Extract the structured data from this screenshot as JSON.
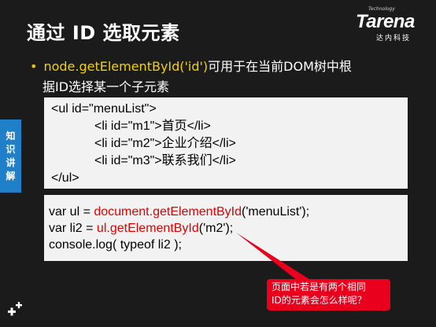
{
  "slide": {
    "title": "通过 ID 选取元素",
    "side_tab": [
      "知",
      "识",
      "讲",
      "解"
    ]
  },
  "logo": {
    "small": "Technology",
    "main": "Tarena",
    "sub": "达内科技"
  },
  "bullet": {
    "dot": "•",
    "code": "node.getElementById('id')",
    "text1": "可用于在当前DOM树中根",
    "text2": "据ID选择某一个子元素"
  },
  "code_html": {
    "line1": "<ul id=\"menuList\">",
    "line2_pre": "<li id=\"m1\">",
    "line2_text": "首页",
    "line2_post": "</li>",
    "line3_pre": "<li id=\"m2\">",
    "line3_text": "企业介绍",
    "line3_post": "</li>",
    "line4_pre": "<li id=\"m3\">",
    "line4_text": "联系我们",
    "line4_post": "</li>",
    "line5": "</ul>"
  },
  "code_js": {
    "line1_a": "var ul = ",
    "line1_b": "document.getElementById",
    "line1_c": "('menuList');",
    "line2_a": "var li2 = ",
    "line2_b": "ul.getElementById",
    "line2_c": "('m2');",
    "line3": "console.log( typeof li2 );"
  },
  "callout": {
    "line1": "页面中若是有两个相同",
    "line2": "ID的元素会怎么样呢？"
  },
  "colors": {
    "background": "#1b1b1b",
    "accent_yellow": "#f2d200",
    "code_red": "#e20000",
    "callout_red": "#e8001c",
    "side_tab_blue": "#1f7fc8"
  }
}
